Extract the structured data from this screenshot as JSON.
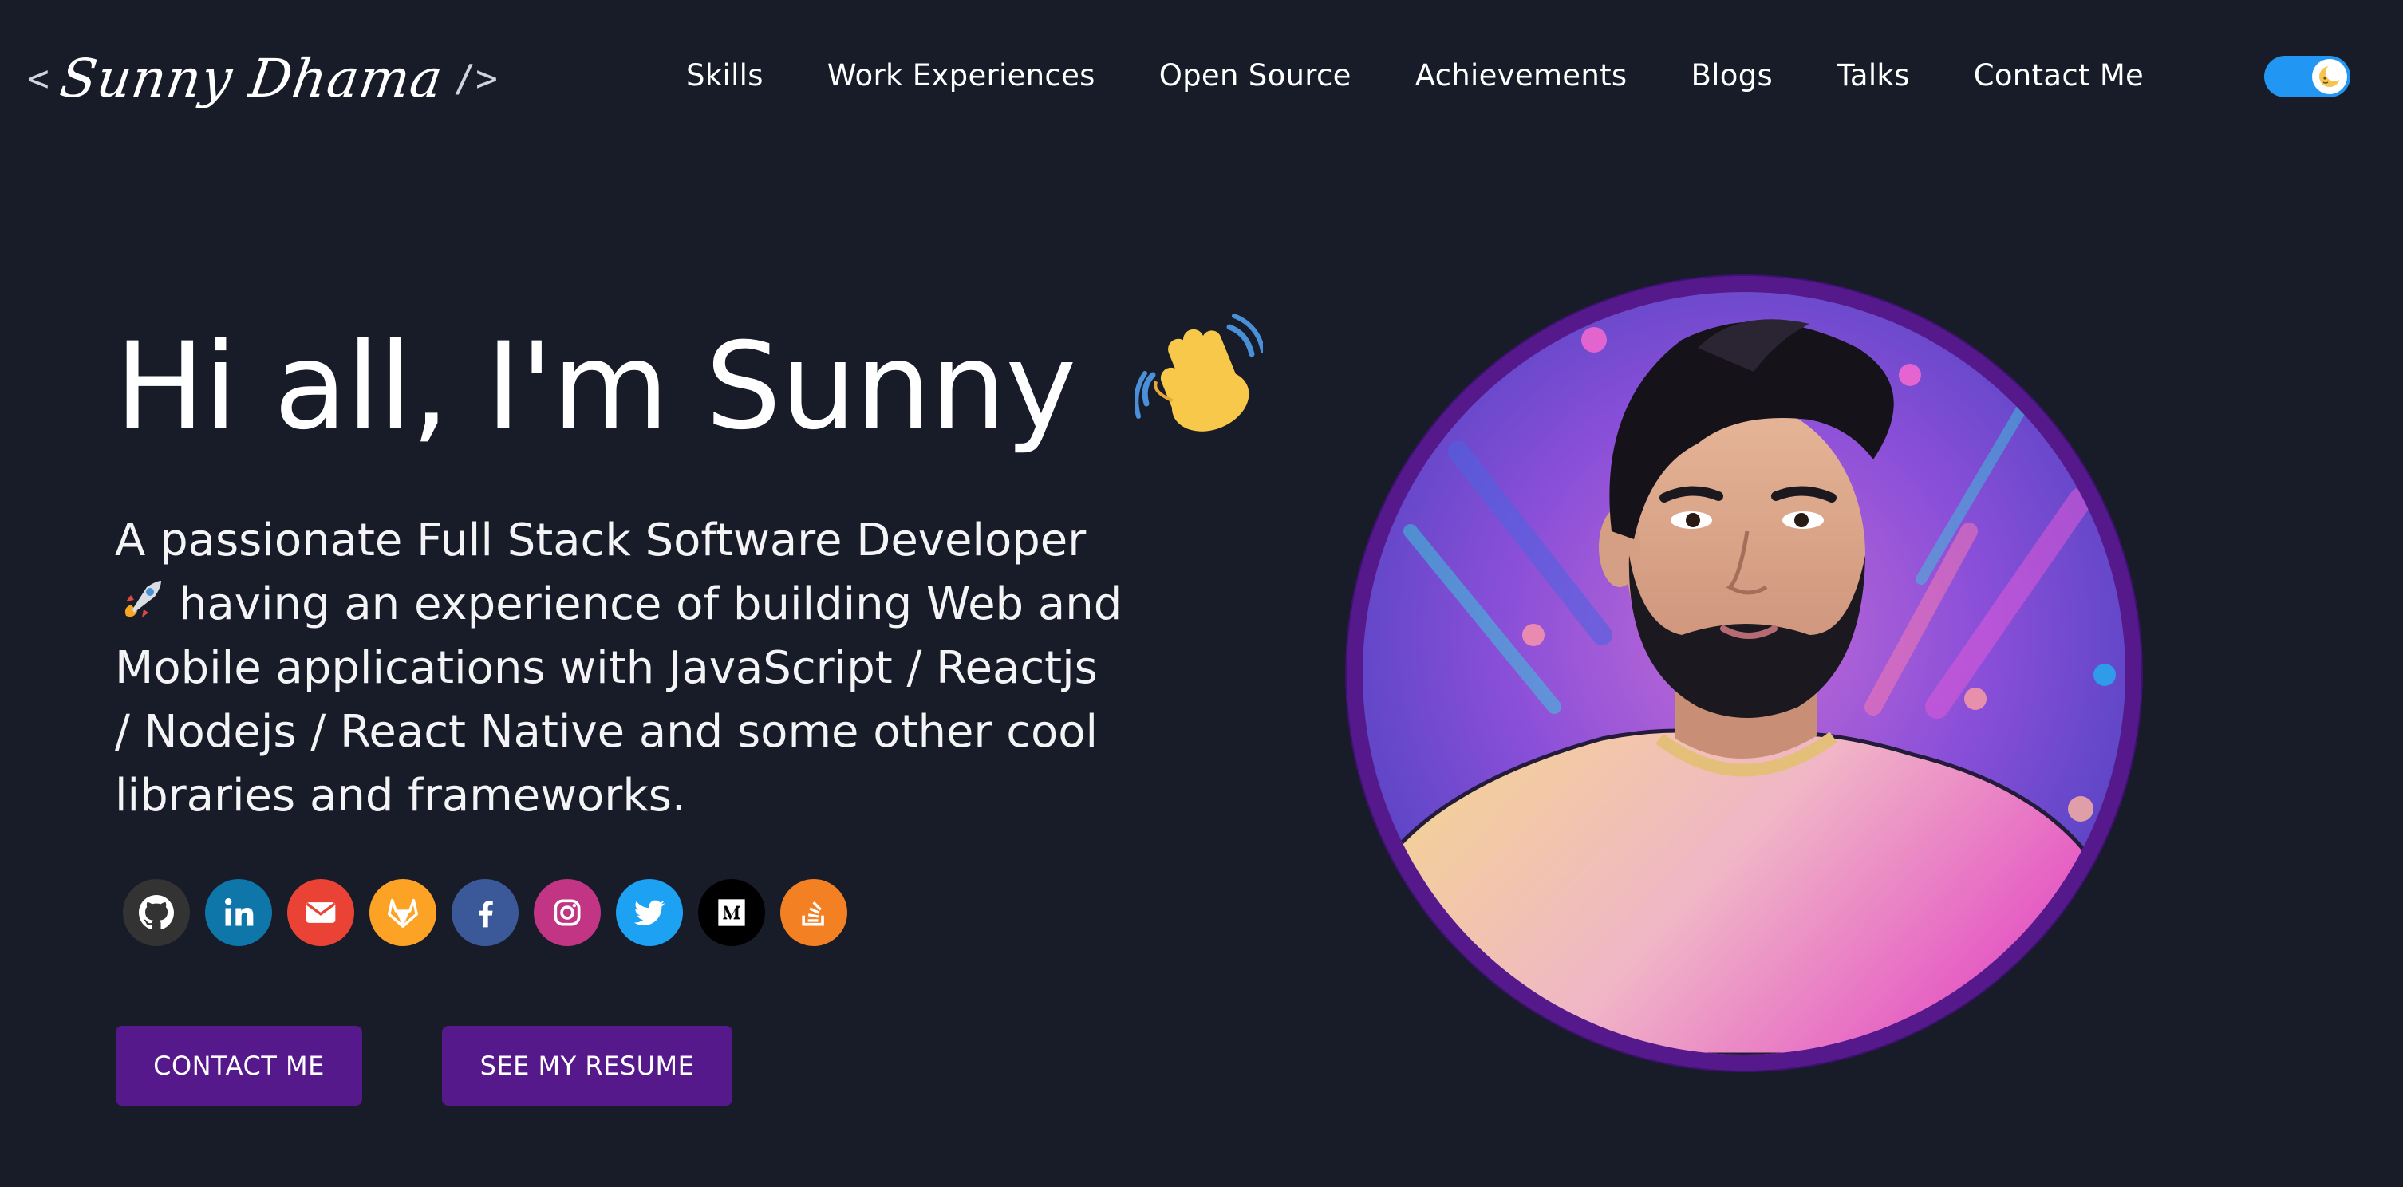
{
  "header": {
    "logo": {
      "open_bracket": "<",
      "name": "Sunny Dhama",
      "close_bracket": "/>"
    },
    "nav": [
      {
        "label": "Skills"
      },
      {
        "label": "Work Experiences"
      },
      {
        "label": "Open Source"
      },
      {
        "label": "Achievements"
      },
      {
        "label": "Blogs"
      },
      {
        "label": "Talks"
      },
      {
        "label": "Contact Me"
      }
    ],
    "theme_toggle": {
      "state": "on",
      "icon": "moon-icon",
      "color": "#2196f3"
    }
  },
  "hero": {
    "greeting": "Hi all, I'm Sunny",
    "greeting_emoji": "waving-hand-icon",
    "subtitle_lines": [
      "A passionate Full Stack Software Developer",
      "having an experience of building Web and",
      "Mobile applications with JavaScript / Reactjs",
      "/ Nodejs / React Native and some other cool",
      "libraries and frameworks."
    ],
    "subtitle_emoji": "rocket-icon",
    "social_links": [
      {
        "name": "github-icon",
        "color": "#333333"
      },
      {
        "name": "linkedin-icon",
        "color": "#0e76a8"
      },
      {
        "name": "email-icon",
        "color": "#ea4335"
      },
      {
        "name": "gitlab-icon",
        "color": "#fca326"
      },
      {
        "name": "facebook-icon",
        "color": "#3b5998"
      },
      {
        "name": "instagram-icon",
        "color": "#c13584"
      },
      {
        "name": "twitter-icon",
        "color": "#1da1f2"
      },
      {
        "name": "medium-icon",
        "color": "#000000"
      },
      {
        "name": "stackoverflow-icon",
        "color": "#f48024"
      }
    ],
    "buttons": {
      "contact": "CONTACT ME",
      "resume": "SEE MY RESUME"
    },
    "portrait": {
      "name": "profile-portrait",
      "ring_color": "#55198b"
    }
  },
  "colors": {
    "background": "#171c28",
    "button": "#55198b",
    "text": "#ffffff"
  }
}
